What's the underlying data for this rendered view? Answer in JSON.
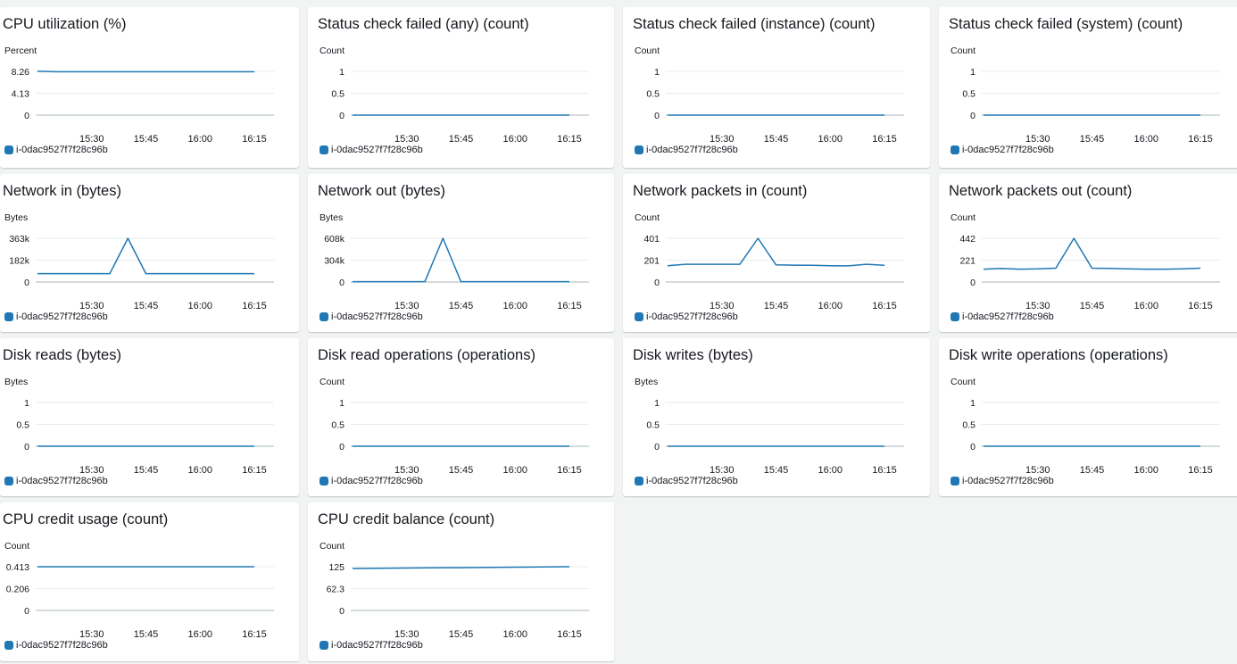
{
  "instance_id": "i-0dac9527f7f28c96b",
  "series_color": "#1f78b4",
  "chart_data": [
    {
      "type": "line",
      "title": "CPU utilization (%)",
      "ylabel": "Percent",
      "yticks": [
        "0",
        "4.13",
        "8.26"
      ],
      "ylim": [
        0,
        8.26
      ],
      "xticks": [
        "15:30",
        "15:45",
        "16:00",
        "16:15"
      ],
      "series": [
        {
          "name": "i-0dac9527f7f28c96b",
          "x": [
            "15:15",
            "15:20",
            "15:25",
            "15:30",
            "15:35",
            "15:40",
            "15:45",
            "15:50",
            "15:55",
            "16:00",
            "16:05",
            "16:10",
            "16:15"
          ],
          "values": [
            8.3,
            8.2,
            8.2,
            8.2,
            8.2,
            8.2,
            8.2,
            8.2,
            8.2,
            8.2,
            8.2,
            8.2,
            8.2
          ]
        }
      ]
    },
    {
      "type": "line",
      "title": "Status check failed (any) (count)",
      "ylabel": "Count",
      "yticks": [
        "0",
        "0.5",
        "1"
      ],
      "ylim": [
        0,
        1
      ],
      "xticks": [
        "15:30",
        "15:45",
        "16:00",
        "16:15"
      ],
      "series": [
        {
          "name": "i-0dac9527f7f28c96b",
          "x": [
            "15:15",
            "16:15"
          ],
          "values": [
            0,
            0
          ]
        }
      ]
    },
    {
      "type": "line",
      "title": "Status check failed (instance) (count)",
      "ylabel": "Count",
      "yticks": [
        "0",
        "0.5",
        "1"
      ],
      "ylim": [
        0,
        1
      ],
      "xticks": [
        "15:30",
        "15:45",
        "16:00",
        "16:15"
      ],
      "series": [
        {
          "name": "i-0dac9527f7f28c96b",
          "x": [
            "15:15",
            "16:15"
          ],
          "values": [
            0,
            0
          ]
        }
      ]
    },
    {
      "type": "line",
      "title": "Status check failed (system) (count)",
      "ylabel": "Count",
      "yticks": [
        "0",
        "0.5",
        "1"
      ],
      "ylim": [
        0,
        1
      ],
      "xticks": [
        "15:30",
        "15:45",
        "16:00",
        "16:15"
      ],
      "series": [
        {
          "name": "i-0dac9527f7f28c96b",
          "x": [
            "15:15",
            "16:15"
          ],
          "values": [
            0,
            0
          ]
        }
      ]
    },
    {
      "type": "line",
      "title": "Network in (bytes)",
      "ylabel": "Bytes",
      "yticks": [
        "0",
        "182k",
        "363k"
      ],
      "ylim": [
        0,
        363000
      ],
      "xticks": [
        "15:30",
        "15:45",
        "16:00",
        "16:15"
      ],
      "series": [
        {
          "name": "i-0dac9527f7f28c96b",
          "x": [
            "15:15",
            "15:20",
            "15:25",
            "15:30",
            "15:35",
            "15:40",
            "15:45",
            "15:50",
            "15:55",
            "16:00",
            "16:05",
            "16:10",
            "16:15"
          ],
          "values": [
            70000,
            70000,
            70000,
            70000,
            70000,
            363000,
            70000,
            70000,
            70000,
            70000,
            70000,
            70000,
            70000
          ]
        }
      ]
    },
    {
      "type": "line",
      "title": "Network out (bytes)",
      "ylabel": "Bytes",
      "yticks": [
        "0",
        "304k",
        "608k"
      ],
      "ylim": [
        0,
        608000
      ],
      "xticks": [
        "15:30",
        "15:45",
        "16:00",
        "16:15"
      ],
      "series": [
        {
          "name": "i-0dac9527f7f28c96b",
          "x": [
            "15:15",
            "15:20",
            "15:25",
            "15:30",
            "15:35",
            "15:40",
            "15:45",
            "15:50",
            "15:55",
            "16:00",
            "16:05",
            "16:10",
            "16:15"
          ],
          "values": [
            5000,
            5000,
            5000,
            5000,
            5000,
            608000,
            5000,
            5000,
            5000,
            5000,
            5000,
            5000,
            5000
          ]
        }
      ]
    },
    {
      "type": "line",
      "title": "Network packets in (count)",
      "ylabel": "Count",
      "yticks": [
        "0",
        "201",
        "401"
      ],
      "ylim": [
        0,
        401
      ],
      "xticks": [
        "15:30",
        "15:45",
        "16:00",
        "16:15"
      ],
      "series": [
        {
          "name": "i-0dac9527f7f28c96b",
          "x": [
            "15:15",
            "15:20",
            "15:25",
            "15:30",
            "15:35",
            "15:40",
            "15:45",
            "15:50",
            "15:55",
            "16:00",
            "16:05",
            "16:10",
            "16:15"
          ],
          "values": [
            150,
            163,
            163,
            163,
            163,
            401,
            157,
            155,
            153,
            150,
            148,
            163,
            153
          ]
        }
      ]
    },
    {
      "type": "line",
      "title": "Network packets out (count)",
      "ylabel": "Count",
      "yticks": [
        "0",
        "221",
        "442"
      ],
      "ylim": [
        0,
        442
      ],
      "xticks": [
        "15:30",
        "15:45",
        "16:00",
        "16:15"
      ],
      "series": [
        {
          "name": "i-0dac9527f7f28c96b",
          "x": [
            "15:15",
            "15:20",
            "15:25",
            "15:30",
            "15:35",
            "15:40",
            "15:45",
            "15:50",
            "15:55",
            "16:00",
            "16:05",
            "16:10",
            "16:15"
          ],
          "values": [
            130,
            137,
            130,
            133,
            140,
            442,
            140,
            137,
            133,
            130,
            130,
            133,
            140
          ]
        }
      ]
    },
    {
      "type": "line",
      "title": "Disk reads (bytes)",
      "ylabel": "Bytes",
      "yticks": [
        "0",
        "0.5",
        "1"
      ],
      "ylim": [
        0,
        1
      ],
      "xticks": [
        "15:30",
        "15:45",
        "16:00",
        "16:15"
      ],
      "series": [
        {
          "name": "i-0dac9527f7f28c96b",
          "x": [
            "15:15",
            "16:15"
          ],
          "values": [
            0,
            0
          ]
        }
      ]
    },
    {
      "type": "line",
      "title": "Disk read operations (operations)",
      "ylabel": "Count",
      "yticks": [
        "0",
        "0.5",
        "1"
      ],
      "ylim": [
        0,
        1
      ],
      "xticks": [
        "15:30",
        "15:45",
        "16:00",
        "16:15"
      ],
      "series": [
        {
          "name": "i-0dac9527f7f28c96b",
          "x": [
            "15:15",
            "16:15"
          ],
          "values": [
            0,
            0
          ]
        }
      ]
    },
    {
      "type": "line",
      "title": "Disk writes (bytes)",
      "ylabel": "Bytes",
      "yticks": [
        "0",
        "0.5",
        "1"
      ],
      "ylim": [
        0,
        1
      ],
      "xticks": [
        "15:30",
        "15:45",
        "16:00",
        "16:15"
      ],
      "series": [
        {
          "name": "i-0dac9527f7f28c96b",
          "x": [
            "15:15",
            "16:15"
          ],
          "values": [
            0,
            0
          ]
        }
      ]
    },
    {
      "type": "line",
      "title": "Disk write operations (operations)",
      "ylabel": "Count",
      "yticks": [
        "0",
        "0.5",
        "1"
      ],
      "ylim": [
        0,
        1
      ],
      "xticks": [
        "15:30",
        "15:45",
        "16:00",
        "16:15"
      ],
      "series": [
        {
          "name": "i-0dac9527f7f28c96b",
          "x": [
            "15:15",
            "16:15"
          ],
          "values": [
            0,
            0
          ]
        }
      ]
    },
    {
      "type": "line",
      "title": "CPU credit usage (count)",
      "ylabel": "Count",
      "yticks": [
        "0",
        "0.206",
        "0.413"
      ],
      "ylim": [
        0,
        0.413
      ],
      "xticks": [
        "15:30",
        "15:45",
        "16:00",
        "16:15"
      ],
      "series": [
        {
          "name": "i-0dac9527f7f28c96b",
          "x": [
            "15:15",
            "16:15"
          ],
          "values": [
            0.413,
            0.413
          ]
        }
      ]
    },
    {
      "type": "line",
      "title": "CPU credit balance (count)",
      "ylabel": "Count",
      "yticks": [
        "0",
        "62.3",
        "125"
      ],
      "ylim": [
        0,
        125
      ],
      "xticks": [
        "15:30",
        "15:45",
        "16:00",
        "16:15"
      ],
      "series": [
        {
          "name": "i-0dac9527f7f28c96b",
          "x": [
            "15:15",
            "16:15"
          ],
          "values": [
            120,
            125
          ]
        }
      ]
    }
  ]
}
